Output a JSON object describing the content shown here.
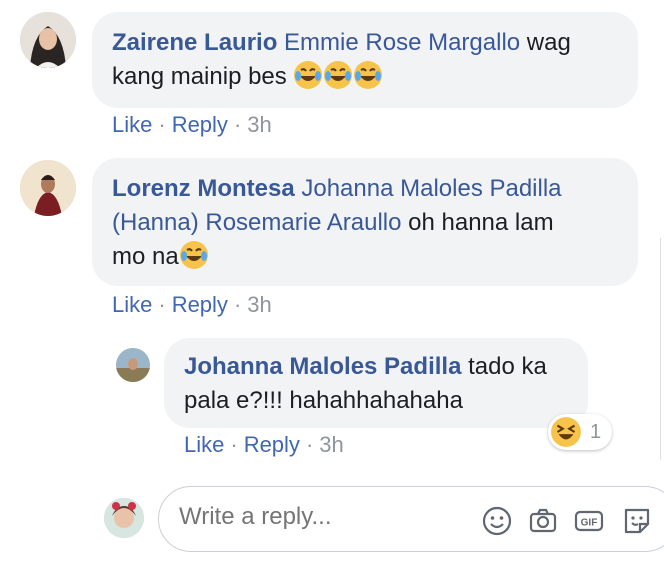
{
  "comments": [
    {
      "author": "Zairene Laurio",
      "mention": "Emmie Rose Margallo",
      "text_after_mention": " wag",
      "text_line2": "kang mainip bes ",
      "emojis": [
        "laughing-crying",
        "laughing-crying",
        "laughing-crying"
      ],
      "like_label": "Like",
      "reply_label": "Reply",
      "time": "3h"
    },
    {
      "author": "Lorenz Montesa",
      "mention": "Johanna Maloles Padilla",
      "mention2": "(Hanna) Rosemarie Araullo",
      "text_after_mention": " oh hanna lam",
      "text_line3": "mo na",
      "emojis": [
        "laughing-crying"
      ],
      "like_label": "Like",
      "reply_label": "Reply",
      "time": "3h"
    }
  ],
  "reply": {
    "author": "Johanna Maloles Padilla",
    "text_part1": " tado ka",
    "text_part2": "pala e?!!! hahahhahahaha",
    "like_label": "Like",
    "reply_label": "Reply",
    "time": "3h",
    "reaction": {
      "icon": "laughing-squint",
      "count": "1"
    }
  },
  "reply_box": {
    "placeholder": "Write a reply...",
    "icons": [
      "emoji-icon",
      "camera-icon",
      "gif-icon",
      "sticker-icon"
    ]
  },
  "colors": {
    "link": "#385898",
    "action": "#4267b2",
    "muted": "#90949c",
    "bubble": "#f2f3f5"
  }
}
